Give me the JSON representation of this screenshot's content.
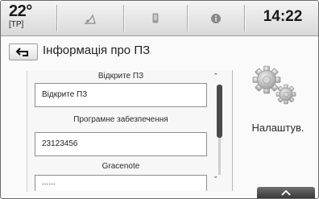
{
  "status_bar": {
    "temperature": "22°",
    "temperature_sub": "[TP]",
    "time": "14:22",
    "tabs": [
      {
        "icon": "music-note-icon"
      },
      {
        "icon": "phone-icon"
      },
      {
        "icon": "info-circle-icon"
      }
    ]
  },
  "header": {
    "back_icon": "back-arrow-icon",
    "title": "Інформація про ПЗ"
  },
  "list": {
    "items": [
      {
        "label": "Відкрите ПЗ",
        "value": "Відкрите ПЗ"
      },
      {
        "label": "Програмне забезпечення",
        "value": "23123456"
      },
      {
        "label": "Gracenote",
        "value": "......"
      }
    ]
  },
  "settings": {
    "icon": "gears-icon",
    "label": "Налаштув."
  },
  "footer": {
    "collapse_icon": "chevron-up-icon"
  }
}
